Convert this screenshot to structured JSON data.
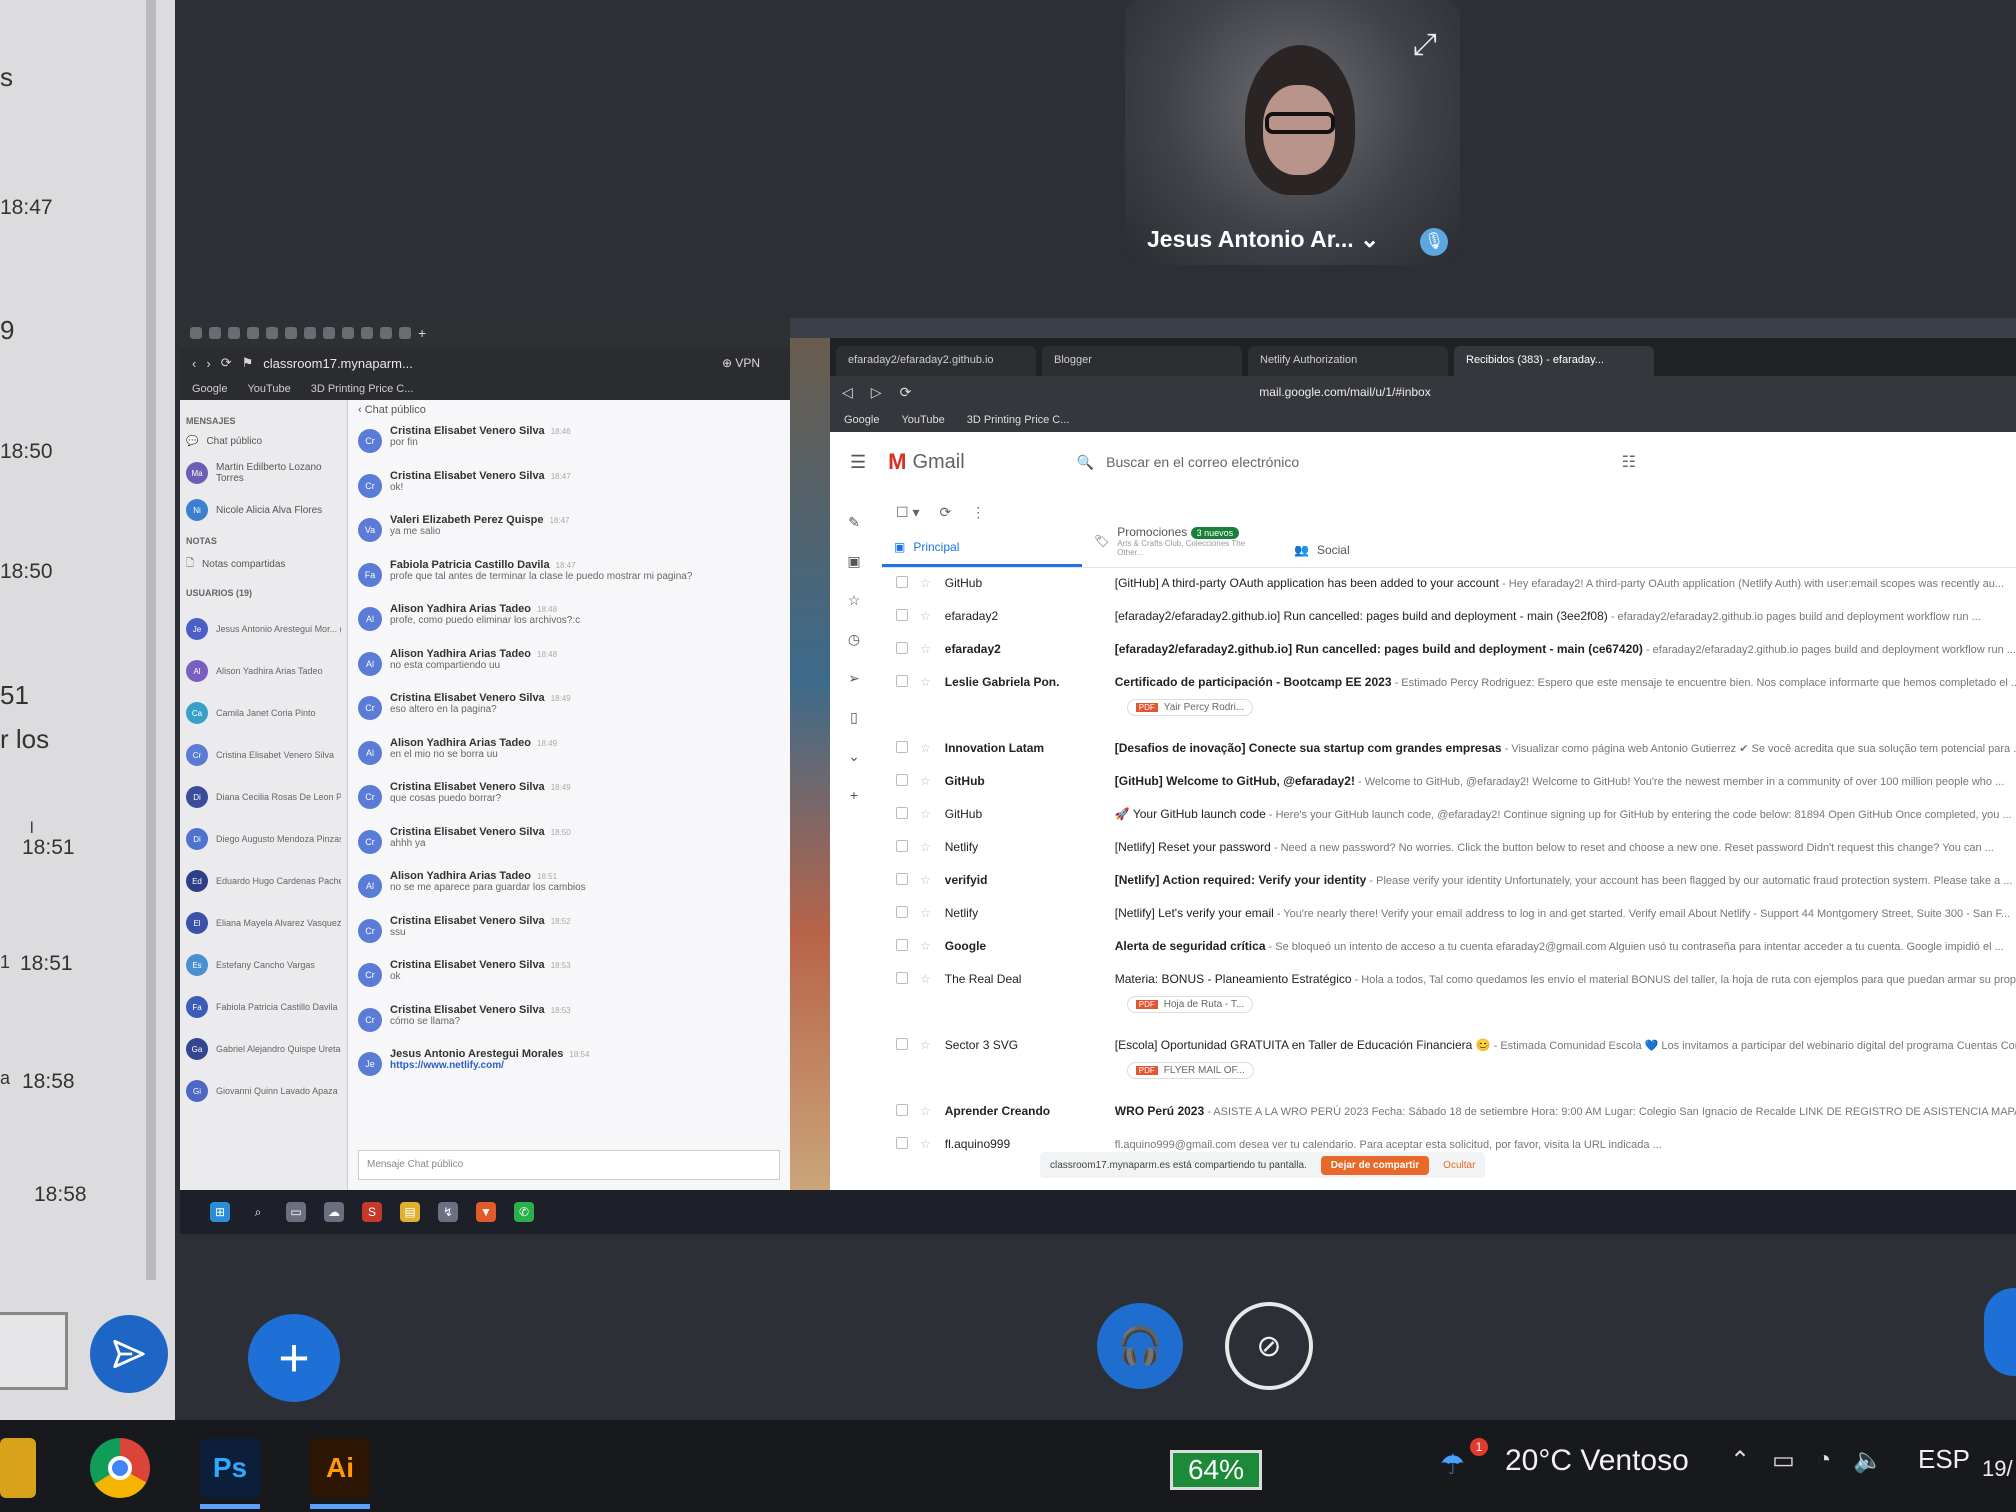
{
  "left_panel": {
    "fragments": [
      "s",
      "9",
      "51",
      "r los",
      "l",
      "1",
      "a"
    ],
    "times": [
      "18:47",
      "18:50",
      "18:50",
      "18:51",
      "18:51",
      "18:58",
      "18:58"
    ]
  },
  "video": {
    "participant_name": "Jesus Antonio Ar... ⌄"
  },
  "chat_browser": {
    "url": "classroom17.mynaparm...",
    "vpn": "⊕ VPN",
    "bookmarks": [
      "Google",
      "YouTube",
      "3D Printing Price C..."
    ],
    "sidebar": {
      "messages_heading": "MENSAJES",
      "public_chat": "Chat público",
      "dm": [
        {
          "initials": "Ma",
          "name": "Martin Edilberto Lozano Torres"
        },
        {
          "initials": "Ni",
          "name": "Nicole Alicia Alva Flores"
        }
      ],
      "notes_heading": "NOTAS",
      "shared_notes": "Notas compartidas",
      "users_heading": "USUARIOS (19)",
      "users": [
        {
          "initials": "Je",
          "name": "Jesus Antonio Arestegui Mor... (Usted)"
        },
        {
          "initials": "Al",
          "name": "Alison Yadhira Arias Tadeo"
        },
        {
          "initials": "Ca",
          "name": "Camila Janet Coria Pinto"
        },
        {
          "initials": "Cr",
          "name": "Cristina Elisabet Venero Silva"
        },
        {
          "initials": "Di",
          "name": "Diana Cecilia Rosas De Leon Pérez"
        },
        {
          "initials": "Di",
          "name": "Diego Augusto Mendoza Pinzas"
        },
        {
          "initials": "Ed",
          "name": "Eduardo Hugo Cardenas Pacheco"
        },
        {
          "initials": "El",
          "name": "Eliana Mayela Alvarez Vasquez"
        },
        {
          "initials": "Es",
          "name": "Estefany Cancho Vargas"
        },
        {
          "initials": "Fa",
          "name": "Fabiola Patricia Castillo Davila"
        },
        {
          "initials": "Ga",
          "name": "Gabriel Alejandro Quispe Ureta"
        },
        {
          "initials": "Gi",
          "name": "Giovanni Quinn Lavado Apaza"
        }
      ]
    },
    "chat": {
      "header": "‹ Chat público",
      "messages": [
        {
          "initials": "Cr",
          "name": "Cristina Elisabet Venero Silva",
          "time": "18:46",
          "text": "por fin"
        },
        {
          "initials": "Cr",
          "name": "Cristina Elisabet Venero Silva",
          "time": "18:47",
          "text": "ok!"
        },
        {
          "initials": "Va",
          "name": "Valeri Elizabeth Perez Quispe",
          "time": "18:47",
          "text": "ya me salio"
        },
        {
          "initials": "Fa",
          "name": "Fabiola Patricia Castillo Davila",
          "time": "18:47",
          "text": "profe que tal antes de terminar la clase le puedo mostrar mi pagina?"
        },
        {
          "initials": "Al",
          "name": "Alison Yadhira Arias Tadeo",
          "time": "18:48",
          "text": "profe, como puedo eliminar los archivos?:c"
        },
        {
          "initials": "Al",
          "name": "Alison Yadhira Arias Tadeo",
          "time": "18:48",
          "text": "no esta compartiendo uu"
        },
        {
          "initials": "Cr",
          "name": "Cristina Elisabet Venero Silva",
          "time": "18:49",
          "text": "eso altero en la pagina?"
        },
        {
          "initials": "Al",
          "name": "Alison Yadhira Arias Tadeo",
          "time": "18:49",
          "text": "en el mio no se borra uu"
        },
        {
          "initials": "Cr",
          "name": "Cristina Elisabet Venero Silva",
          "time": "18:49",
          "text": "que cosas puedo borrar?"
        },
        {
          "initials": "Cr",
          "name": "Cristina Elisabet Venero Silva",
          "time": "18:50",
          "text": "ahhh ya"
        },
        {
          "initials": "Al",
          "name": "Alison Yadhira Arias Tadeo",
          "time": "18:51",
          "text": "no se me aparece para guardar los cambios"
        },
        {
          "initials": "Cr",
          "name": "Cristina Elisabet Venero Silva",
          "time": "18:52",
          "text": "ssu"
        },
        {
          "initials": "Cr",
          "name": "Cristina Elisabet Venero Silva",
          "time": "18:53",
          "text": "ok"
        },
        {
          "initials": "Cr",
          "name": "Cristina Elisabet Venero Silva",
          "time": "18:53",
          "text": "cómo se llama?"
        },
        {
          "initials": "Je",
          "name": "Jesus Antonio Arestegui Morales",
          "time": "18:54",
          "text": "https://www.netlify.com/",
          "link": true
        }
      ],
      "compose_placeholder": "Mensaje Chat público"
    }
  },
  "gmail_browser": {
    "tabs": [
      "efaraday2/efaraday2.github.io",
      "Blogger",
      "Netlify Authorization",
      "Recibidos (383) - efaraday..."
    ],
    "url": "mail.google.com/mail/u/1/#inbox",
    "bookmarks": [
      "Google",
      "YouTube",
      "3D Printing Price C..."
    ],
    "logo": "Gmail",
    "search_placeholder": "Buscar en el correo electrónico",
    "categories": [
      {
        "label": "Principal",
        "active": true
      },
      {
        "label": "Promociones",
        "badge": "3 nuevos",
        "sub": "Arts & Crafts Club, Colecciones The Other..."
      },
      {
        "label": "Social"
      }
    ],
    "emails": [
      {
        "sender": "GitHub",
        "unread": false,
        "subject": "[GitHub] A third-party OAuth application has been added to your account",
        "snippet": " - Hey efaraday2! A third-party OAuth application (Netlify Auth) with user:email scopes was recently au..."
      },
      {
        "sender": "efaraday2",
        "unread": false,
        "subject": "[efaraday2/efaraday2.github.io] Run cancelled: pages build and deployment - main (3ee2f08)",
        "snippet": " - efaraday2/efaraday2.github.io pages build and deployment workflow run ..."
      },
      {
        "sender": "efaraday2",
        "unread": true,
        "subject": "[efaraday2/efaraday2.github.io] Run cancelled: pages build and deployment - main (ce67420)",
        "snippet": " - efaraday2/efaraday2.github.io pages build and deployment workflow run ..."
      },
      {
        "sender": "Leslie Gabriela Pon.",
        "unread": true,
        "subject": "Certificado de participación - Bootcamp EE 2023",
        "snippet": " - Estimado Percy Rodriguez: Espero que este mensaje te encuentre bien. Nos complace informarte que hemos completado el ...",
        "attachment": "Yair Percy Rodri..."
      },
      {
        "sender": "Innovation Latam",
        "unread": true,
        "subject": "[Desafios de inovação] Conecte sua startup com grandes empresas",
        "snippet": " - Visualizar como página web Antonio Gutierrez ✔ Se você acredita que sua solução tem potencial para ..."
      },
      {
        "sender": "GitHub",
        "unread": true,
        "subject": "[GitHub] Welcome to GitHub, @efaraday2!",
        "snippet": " - Welcome to GitHub, @efaraday2! Welcome to GitHub! You're the newest member in a community of over 100 million people who ..."
      },
      {
        "sender": "GitHub",
        "unread": false,
        "subject": "🚀 Your GitHub launch code",
        "snippet": " - Here's your GitHub launch code, @efaraday2! Continue signing up for GitHub by entering the code below: 81894 Open GitHub Once completed, you ..."
      },
      {
        "sender": "Netlify",
        "unread": false,
        "subject": "[Netlify] Reset your password",
        "snippet": " - Need a new password? No worries. Click the button below to reset and choose a new one. Reset password Didn't request this change? You can ..."
      },
      {
        "sender": "verifyid",
        "unread": true,
        "subject": "[Netlify] Action required: Verify your identity",
        "snippet": " - Please verify your identity Unfortunately, your account has been flagged by our automatic fraud protection system. Please take a ..."
      },
      {
        "sender": "Netlify",
        "unread": false,
        "subject": "[Netlify] Let's verify your email",
        "snippet": " - You're nearly there! Verify your email address to log in and get started. Verify email About Netlify - Support 44 Montgomery Street, Suite 300 - San F..."
      },
      {
        "sender": "Google",
        "unread": true,
        "subject": "Alerta de seguridad crítica",
        "snippet": " - Se bloqueó un intento de acceso a tu cuenta efaraday2@gmail.com Alguien usó tu contraseña para intentar acceder a tu cuenta. Google impidió el ..."
      },
      {
        "sender": "The Real Deal",
        "unread": false,
        "subject": "Materia: BONUS - Planeamiento Estratégico",
        "snippet": " - Hola a todos, Tal como quedamos les envío el material BONUS del taller, la hoja de ruta con ejemplos para que puedan armar su propio ...",
        "attachment": "Hoja de Ruta - T..."
      },
      {
        "sender": "Sector 3 SVG",
        "unread": false,
        "subject": "[Escola] Oportunidad GRATUITA en Taller de Educación Financiera 😊",
        "snippet": " - Estimada Comunidad Escola 💙 Los invitamos a participar del webinario digital del programa Cuentas Conscientes ...",
        "attachment": "FLYER MAIL OF..."
      },
      {
        "sender": "Aprender Creando",
        "unread": true,
        "subject": "WRO Perú 2023",
        "snippet": " - ASISTE A LA WRO PERÚ 2023 Fecha: Sábado 18 de setiembre Hora: 9:00 AM Lugar: Colegio San Ignacio de Recalde LINK DE REGISTRO DE ASISTENCIA MAPA DE UBICACIÓN ..."
      },
      {
        "sender": "fl.aquino999",
        "unread": false,
        "subject": "",
        "snippet": "fl.aquino999@gmail.com desea ver tu calendario. Para aceptar esta solicitud, por favor, visita la URL indicada ..."
      }
    ],
    "share_notice": "classroom17.mynaparm.es está compartiendo tu pantalla.",
    "share_stop": "Dejar de compartir",
    "share_hide": "Ocultar"
  },
  "controls": {
    "headset_icon": "headset-icon",
    "camera_icon": "camera-off-icon",
    "add_icon": "plus-icon"
  },
  "taskbar": {
    "apps": [
      "Ps",
      "Ai"
    ],
    "battery": "64%",
    "weather": "20°C  Ventoso",
    "weather_badge": "1",
    "language": "ESP",
    "date_fragment": "19/"
  },
  "colors": {
    "accent_blue": "#1e70d6",
    "gmail_red": "#d93025",
    "share_orange": "#e8692a",
    "battery_green": "#1d8a39"
  }
}
